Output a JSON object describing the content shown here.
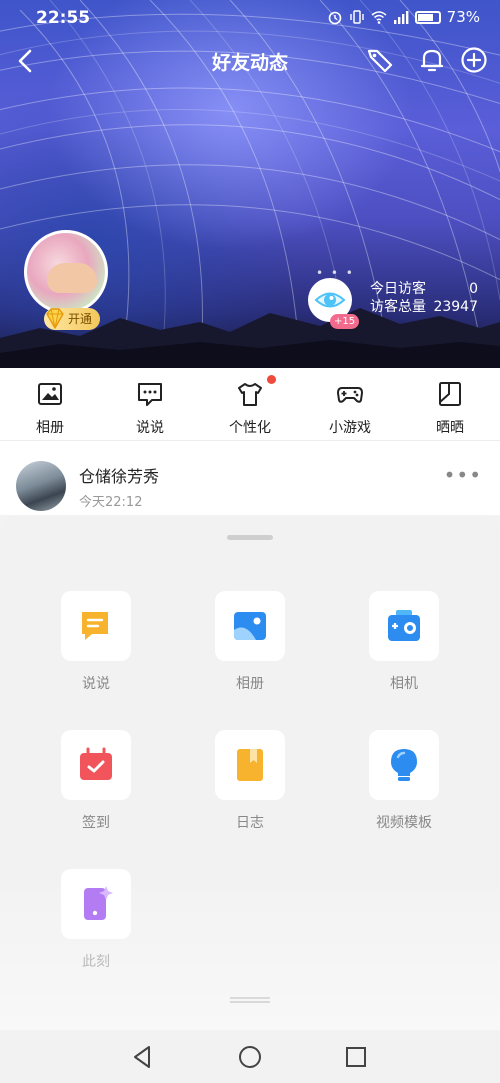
{
  "status_bar": {
    "time": "22:55",
    "battery": "73%",
    "network": "4G"
  },
  "title_bar": {
    "title": "好友动态"
  },
  "profile": {
    "vip_label": "开通"
  },
  "visitors": {
    "today_label": "今日访客",
    "today_count": "0",
    "total_label": "访客总量",
    "total_count": "23947",
    "plus_badge": "+15"
  },
  "tabs": [
    {
      "label": "相册",
      "icon": "photo-album-icon"
    },
    {
      "label": "说说",
      "icon": "chat-bubble-icon"
    },
    {
      "label": "个性化",
      "icon": "tshirt-icon",
      "has_dot": true
    },
    {
      "label": "小游戏",
      "icon": "gamepad-icon"
    },
    {
      "label": "晒晒",
      "icon": "layout-icon"
    }
  ],
  "feed": {
    "name": "仓储徐芳秀",
    "time": "今天22:12"
  },
  "sheet": {
    "items": [
      {
        "label": "说说",
        "icon": "post-icon"
      },
      {
        "label": "相册",
        "icon": "album-icon"
      },
      {
        "label": "相机",
        "icon": "camera-icon"
      },
      {
        "label": "签到",
        "icon": "checkin-icon"
      },
      {
        "label": "日志",
        "icon": "journal-icon"
      },
      {
        "label": "视频模板",
        "icon": "video-template-icon"
      },
      {
        "label": "此刻",
        "icon": "moment-icon"
      }
    ]
  },
  "colors": {
    "accent_blue": "#2d8cf0",
    "orange": "#f7b22e",
    "red": "#f2545b",
    "purple": "#b37cf2",
    "dot_red": "#ef4a3b"
  }
}
